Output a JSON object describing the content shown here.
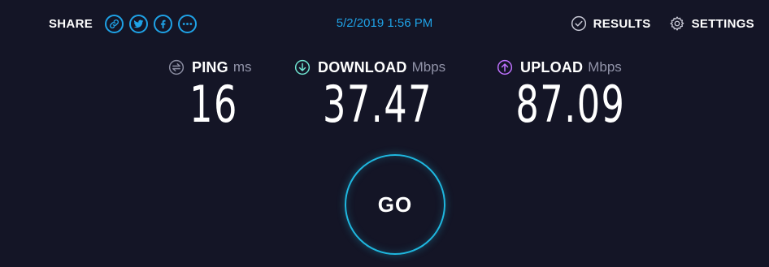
{
  "share": {
    "label": "SHARE",
    "buttons": [
      "link",
      "twitter",
      "facebook",
      "more"
    ]
  },
  "header": {
    "datetime": "5/2/2019 1:56 PM",
    "results_label": "RESULTS",
    "settings_label": "SETTINGS"
  },
  "metrics": {
    "ping": {
      "name": "PING",
      "unit": "ms",
      "value": "16",
      "icon": "ping-icon",
      "icon_color": "#8a8ca0"
    },
    "download": {
      "name": "DOWNLOAD",
      "unit": "Mbps",
      "value": "37.47",
      "icon": "download-arrow-icon",
      "icon_color": "#6fe3d0"
    },
    "upload": {
      "name": "UPLOAD",
      "unit": "Mbps",
      "value": "87.09",
      "icon": "upload-arrow-icon",
      "icon_color": "#bf71ff"
    }
  },
  "go_button": {
    "label": "GO"
  },
  "colors": {
    "background": "#141526",
    "accent": "#1fa2e6",
    "go_ring": "#1fb7df",
    "muted": "#9193a8"
  }
}
